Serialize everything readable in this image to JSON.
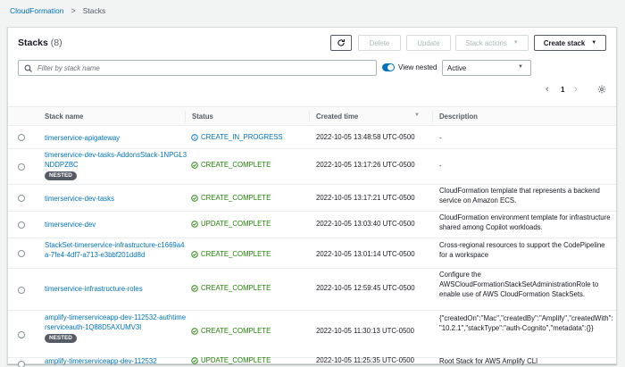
{
  "breadcrumb": {
    "root": "CloudFormation",
    "separator": ">",
    "current": "Stacks"
  },
  "header": {
    "title": "Stacks",
    "count": "(8)"
  },
  "toolbar": {
    "delete_label": "Delete",
    "update_label": "Update",
    "stack_actions_label": "Stack actions",
    "create_stack_label": "Create stack"
  },
  "filter": {
    "placeholder": "Filter by stack name",
    "value": ""
  },
  "view_nested": {
    "label": "View nested",
    "enabled": true
  },
  "status_filter": {
    "selected": "Active"
  },
  "pagination": {
    "prev": "‹",
    "page": "1",
    "next": "›"
  },
  "table": {
    "columns": {
      "name": "Stack name",
      "status": "Status",
      "created": "Created time",
      "description": "Description"
    },
    "rows": [
      {
        "name": "timerservice-apigateway",
        "nested": false,
        "status": "CREATE_IN_PROGRESS",
        "status_kind": "progress",
        "created": "2022-10-05 13:48:58 UTC-0500",
        "description": "-"
      },
      {
        "name": "timerservice-dev-tasks-AddonsStack-1NPGL3NDDPZBC",
        "nested": true,
        "nested_label": "NESTED",
        "status": "CREATE_COMPLETE",
        "status_kind": "complete",
        "created": "2022-10-05 13:17:26 UTC-0500",
        "description": "-"
      },
      {
        "name": "timerservice-dev-tasks",
        "nested": false,
        "status": "CREATE_COMPLETE",
        "status_kind": "complete",
        "created": "2022-10-05 13:17:21 UTC-0500",
        "description": "CloudFormation template that represents a backend service on Amazon ECS."
      },
      {
        "name": "timerservice-dev",
        "nested": false,
        "status": "UPDATE_COMPLETE",
        "status_kind": "complete",
        "created": "2022-10-05 13:03:40 UTC-0500",
        "description": "CloudFormation environment template for infrastructure shared among Copilot workloads."
      },
      {
        "name": "StackSet-timerservice-infrastructure-c1669a4a-7fe4-4df7-a713-e3bbf201dd8d",
        "nested": false,
        "status": "CREATE_COMPLETE",
        "status_kind": "complete",
        "created": "2022-10-05 13:01:14 UTC-0500",
        "description": "Cross-regional resources to support the CodePipeline for a workspace"
      },
      {
        "name": "timerservice-infrastructure-roles",
        "nested": false,
        "status": "CREATE_COMPLETE",
        "status_kind": "complete",
        "created": "2022-10-05 12:59:45 UTC-0500",
        "description": "Configure the AWSCloudFormationStackSetAdministrationRole to enable use of AWS CloudFormation StackSets."
      },
      {
        "name": "amplify-timerserviceapp-dev-112532-authtimerserviceauth-1Q88D5AXUMV3I",
        "nested": true,
        "nested_label": "NESTED",
        "status": "CREATE_COMPLETE",
        "status_kind": "complete",
        "created": "2022-10-05 11:30:13 UTC-0500",
        "description": "{\"createdOn\":\"Mac\",\"createdBy\":\"Amplify\",\"createdWith\":\"10.2.1\",\"stackType\":\"auth-Cognito\",\"metadata\":{}}"
      },
      {
        "name": "amplify-timerserviceapp-dev-112532",
        "nested": false,
        "status": "UPDATE_COMPLETE",
        "status_kind": "complete",
        "created": "2022-10-05 11:25:35 UTC-0500",
        "description": "Root Stack for AWS Amplify CLI"
      }
    ]
  },
  "colors": {
    "link": "#0073bb",
    "success": "#1d8102",
    "in_progress": "#0073bb",
    "badge": "#545b64"
  },
  "icons": {
    "refresh": "refresh-icon",
    "search": "search-icon",
    "settings": "gear-icon",
    "status_complete": "check-circle-icon",
    "status_progress": "info-circle-icon"
  }
}
